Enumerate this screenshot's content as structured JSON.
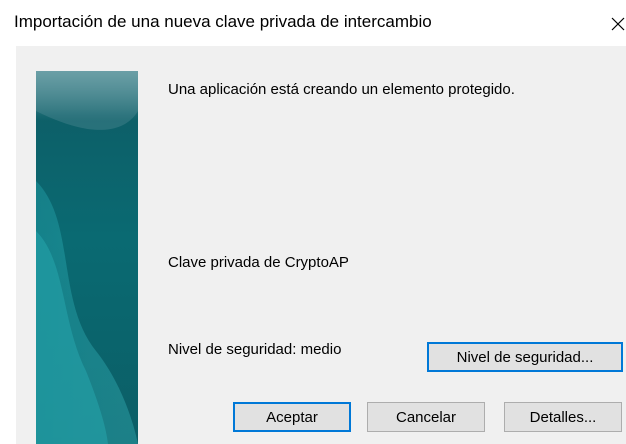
{
  "window": {
    "title": "Importación de una nueva clave privada de intercambio",
    "close_glyph": "✕"
  },
  "content": {
    "message": "Una aplicación está creando un elemento protegido.",
    "key_name": "Clave privada de CryptoAP",
    "security_level_text": "Nivel de seguridad: medio"
  },
  "buttons": {
    "security_level": "Nivel de seguridad...",
    "accept": "Aceptar",
    "cancel": "Cancelar",
    "details": "Detalles..."
  },
  "colors": {
    "dialog_background": "#f0f0f0",
    "default_button_border": "#0078d7",
    "button_face": "#e1e1e1",
    "banner_dark": "#0a5a63",
    "banner_light": "#2aa7ae"
  },
  "icons": {
    "close": "close-icon",
    "banner": "teal-gradient-banner"
  }
}
